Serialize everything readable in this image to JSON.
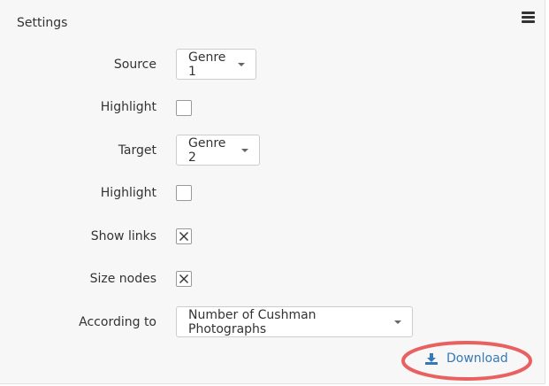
{
  "panel": {
    "title": "Settings",
    "menu_icon": "hamburger-menu-icon"
  },
  "fields": {
    "source": {
      "label": "Source",
      "value": "Genre 1"
    },
    "source_highlight": {
      "label": "Highlight",
      "checked": false
    },
    "target": {
      "label": "Target",
      "value": "Genre 2"
    },
    "target_highlight": {
      "label": "Highlight",
      "checked": false
    },
    "show_links": {
      "label": "Show links",
      "checked": true
    },
    "size_nodes": {
      "label": "Size nodes",
      "checked": true
    },
    "according_to": {
      "label": "According to",
      "value": "Number of Cushman Photographs"
    }
  },
  "download": {
    "label": "Download",
    "icon": "download-icon"
  },
  "colors": {
    "link": "#337ab7",
    "annotation_ellipse": "#e8605f",
    "panel_bg": "#f7f7f7"
  }
}
